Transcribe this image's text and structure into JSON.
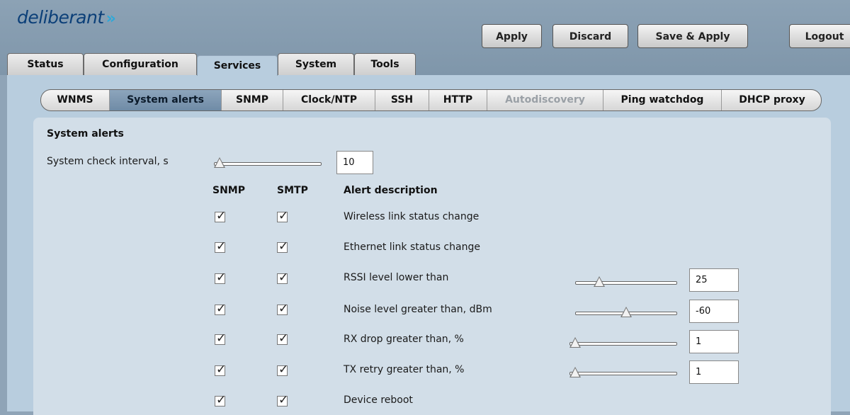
{
  "app": {
    "logo": "deliberant",
    "logo_mark": "»"
  },
  "toolbar": {
    "apply": "Apply",
    "discard": "Discard",
    "save_apply": "Save & Apply",
    "logout": "Logout"
  },
  "tabs": [
    "Status",
    "Configuration",
    "Services",
    "System",
    "Tools"
  ],
  "active_tab": "Services",
  "subtabs": [
    "WNMS",
    "System alerts",
    "SNMP",
    "Clock/NTP",
    "SSH",
    "HTTP",
    "Autodiscovery",
    "Ping watchdog",
    "DHCP proxy"
  ],
  "active_subtab": "System alerts",
  "disabled_subtab": "Autodiscovery",
  "section": {
    "title": "System alerts",
    "interval_label": "System check interval, s",
    "interval_value": "10",
    "col_snmp": "SNMP",
    "col_smtp": "SMTP",
    "col_desc": "Alert description"
  },
  "alerts": [
    {
      "desc": "Wireless link status change",
      "snmp": true,
      "smtp": true
    },
    {
      "desc": "Ethernet link status change",
      "snmp": true,
      "smtp": true
    },
    {
      "desc": "RSSI level lower than",
      "snmp": true,
      "smtp": true,
      "value": "25",
      "slider_level": 0.2
    },
    {
      "desc": "Noise level greater than, dBm",
      "snmp": true,
      "smtp": true,
      "value": "-60",
      "slider_level": 0.5
    },
    {
      "desc": "RX drop greater than, %",
      "snmp": true,
      "smtp": true,
      "value": "1",
      "slider_level": 0.0
    },
    {
      "desc": "TX retry greater than, %",
      "snmp": true,
      "smtp": true,
      "value": "1",
      "slider_level": 0.0
    },
    {
      "desc": "Device reboot",
      "snmp": true,
      "smtp": true
    }
  ],
  "interval_slider_level": 0.0,
  "checkmark": "✓"
}
